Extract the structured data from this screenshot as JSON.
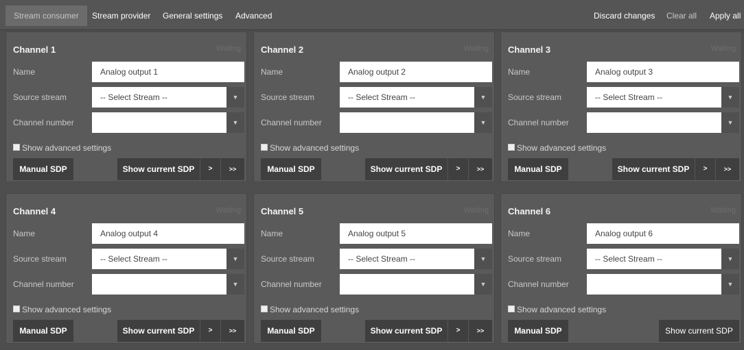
{
  "nav": {
    "tabs": [
      {
        "label": "Stream consumer",
        "active": true
      },
      {
        "label": "Stream provider"
      },
      {
        "label": "General settings"
      },
      {
        "label": "Advanced"
      }
    ],
    "actions": {
      "discard": "Discard changes",
      "clear": "Clear all",
      "apply": "Apply all"
    }
  },
  "channels": [
    {
      "title": "Channel 1",
      "status": "Waiting",
      "name_label": "Name",
      "name_value": "Analog output 1",
      "source_label": "Source stream",
      "source_value": "-- Select Stream --",
      "number_label": "Channel number",
      "number_value": "",
      "advanced_label": "Show advanced settings",
      "manual_label": "Manual SDP",
      "show_label": "Show current SDP",
      "next_label": ">",
      "last_label": ">>"
    },
    {
      "title": "Channel 2",
      "status": "Waiting",
      "name_label": "Name",
      "name_value": "Analog output 2",
      "source_label": "Source stream",
      "source_value": "-- Select Stream --",
      "number_label": "Channel number",
      "number_value": "",
      "advanced_label": "Show advanced settings",
      "manual_label": "Manual SDP",
      "show_label": "Show current SDP",
      "next_label": ">",
      "last_label": ">>"
    },
    {
      "title": "Channel 3",
      "status": "Waiting",
      "name_label": "Name",
      "name_value": "Analog output 3",
      "source_label": "Source stream",
      "source_value": "-- Select Stream --",
      "number_label": "Channel number",
      "number_value": "",
      "advanced_label": "Show advanced settings",
      "manual_label": "Manual SDP",
      "show_label": "Show current SDP",
      "next_label": ">",
      "last_label": ">>"
    },
    {
      "title": "Channel 4",
      "status": "Waiting",
      "name_label": "Name",
      "name_value": "Analog output 4",
      "source_label": "Source stream",
      "source_value": "-- Select Stream --",
      "number_label": "Channel number",
      "number_value": "",
      "advanced_label": "Show advanced settings",
      "manual_label": "Manual SDP",
      "show_label": "Show current SDP",
      "next_label": ">",
      "last_label": ">>"
    },
    {
      "title": "Channel 5",
      "status": "Waiting",
      "name_label": "Name",
      "name_value": "Analog output 5",
      "source_label": "Source stream",
      "source_value": "-- Select Stream --",
      "number_label": "Channel number",
      "number_value": "",
      "advanced_label": "Show advanced settings",
      "manual_label": "Manual SDP",
      "show_label": "Show current SDP",
      "next_label": ">",
      "last_label": ">>"
    },
    {
      "title": "Channel 6",
      "status": "Waiting",
      "name_label": "Name",
      "name_value": "Analog output 6",
      "source_label": "Source stream",
      "source_value": "-- Select Stream --",
      "number_label": "Channel number",
      "number_value": "",
      "advanced_label": "Show advanced settings",
      "manual_label": "Manual SDP",
      "show_label": "Show current SDP",
      "next_label": "",
      "last_label": ""
    }
  ],
  "icons": {
    "dropdown": "caret-down-icon",
    "checkbox": "checkbox-icon"
  },
  "colors": {
    "background": "#4e4e4e",
    "topbar": "#555555",
    "card": "#5a5a5a",
    "button": "#3f3f3f",
    "active_tab": "#6b6b6b"
  }
}
